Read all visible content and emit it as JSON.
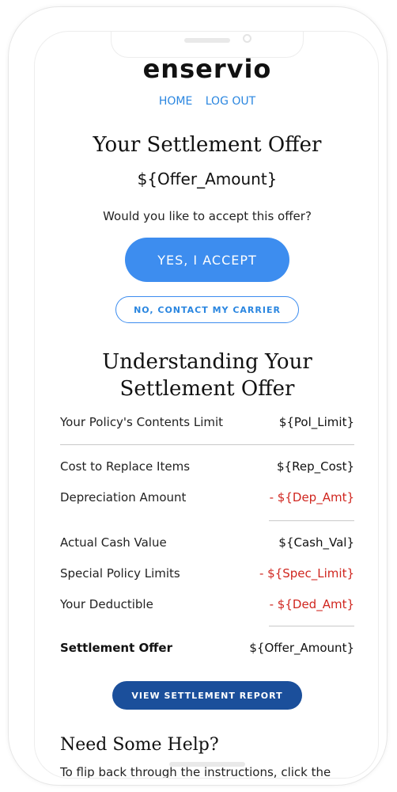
{
  "brand": {
    "logo_text": "enservio"
  },
  "nav": {
    "home": "HOME",
    "logout": "LOG OUT"
  },
  "offer": {
    "title": "Your Settlement Offer",
    "amount": "${Offer_Amount}",
    "question": "Would you like to accept this offer?",
    "accept_label": "YES, I ACCEPT",
    "contact_label": "NO, CONTACT MY CARRIER"
  },
  "understanding": {
    "title_line1": "Understanding Your",
    "title_line2": "Settlement Offer",
    "rows": [
      {
        "label": "Your Policy's Contents Limit",
        "value": "${Pol_Limit}"
      },
      {
        "label": "Cost to Replace Items",
        "value": "${Rep_Cost}"
      },
      {
        "label": "Depreciation Amount",
        "value": "- ${Dep_Amt}"
      },
      {
        "label": "Actual Cash Value",
        "value": "${Cash_Val}"
      },
      {
        "label": "Special Policy Limits",
        "value": "- ${Spec_Limit}"
      },
      {
        "label": "Your Deductible",
        "value": "- ${Ded_Amt}"
      },
      {
        "label": "Settlement Offer",
        "value": "${Offer_Amount}"
      }
    ],
    "report_button": "VIEW SETTLEMENT REPORT"
  },
  "help": {
    "title": "Need Some Help?",
    "text": "To flip back through the instructions, click the"
  },
  "colors": {
    "accent": "#3d8def",
    "dark_button": "#1b4f9b",
    "negative": "#d0261f"
  }
}
